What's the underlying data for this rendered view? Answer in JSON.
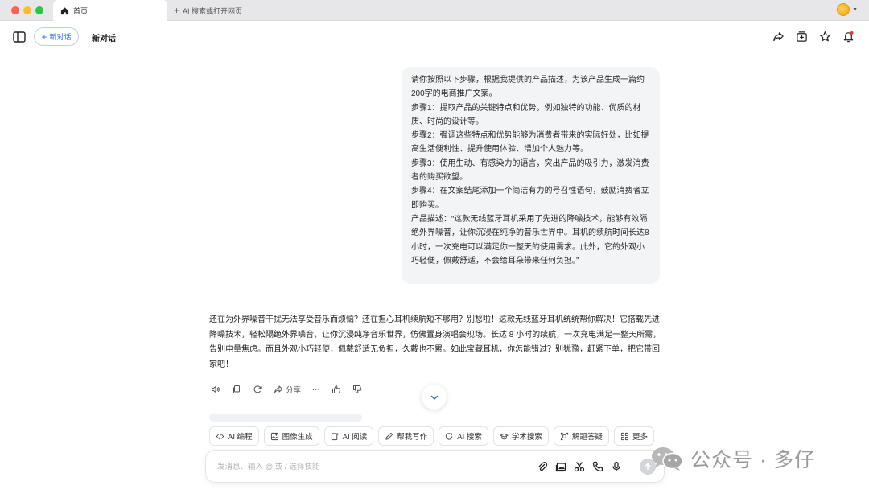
{
  "window": {
    "tab_active_label": "首页",
    "tab_new_label": "AI 搜索或打开网页"
  },
  "toolbar": {
    "new_chat_label": "新对话",
    "conversation_title": "新对话"
  },
  "user_message": {
    "lines": [
      "请你按照以下步骤，根据我提供的产品描述，为该产品生成一篇约200字的电商推广文案。",
      "步骤1：提取产品的关键特点和优势，例如独特的功能、优质的材质、时尚的设计等。",
      "步骤2：强调这些特点和优势能够为消费者带来的实际好处，比如提高生活便利性、提升使用体验、增加个人魅力等。",
      "步骤3：使用生动、有感染力的语言，突出产品的吸引力，激发消费者的购买欲望。",
      "步骤4：在文案结尾添加一个简洁有力的号召性语句，鼓励消费者立即购买。",
      "产品描述：“这款无线蓝牙耳机采用了先进的降噪技术，能够有效隔绝外界噪音，让你沉浸在纯净的音乐世界中。耳机的续航时间长达8小时，一次充电可以满足你一整天的使用需求。此外，它的外观小巧轻便，佩戴舒适，不会给耳朵带来任何负担。”"
    ]
  },
  "assistant_message": {
    "text": "还在为外界噪音干扰无法享受音乐而烦恼？还在担心耳机续航短不够用？别愁啦！这款无线蓝牙耳机统统帮你解决！它搭载先进降噪技术，轻松隔绝外界噪音，让你沉浸纯净音乐世界，仿佛置身演唱会现场。长达 8 小时的续航，一次充电满足一整天所需，告别电量焦虑。而且外观小巧轻便，佩戴舒适无负担，久戴也不累。如此宝藏耳机，你怎能错过？别犹豫，赶紧下单，把它带回家吧！"
  },
  "actions": {
    "share_label": "分享",
    "more_label": "···"
  },
  "skills": [
    {
      "label": "AI 编程",
      "icon": "code-icon"
    },
    {
      "label": "图像生成",
      "icon": "image-icon"
    },
    {
      "label": "AI 阅读",
      "icon": "reading-icon"
    },
    {
      "label": "帮我写作",
      "icon": "pen-icon"
    },
    {
      "label": "AI 搜索",
      "icon": "search-icon"
    },
    {
      "label": "学术搜索",
      "icon": "graduation-cap-icon"
    },
    {
      "label": "解题答疑",
      "icon": "camera-icon"
    },
    {
      "label": "更多",
      "icon": "grid-icon"
    }
  ],
  "input": {
    "placeholder": "发消息、输入 @ 或 / 选择技能"
  },
  "watermark": {
    "text": "公众号 · 多仔"
  },
  "colors": {
    "accent": "#2f6ff0",
    "bubble_bg": "#f3f4f6",
    "notification_dot": "#e53935"
  }
}
